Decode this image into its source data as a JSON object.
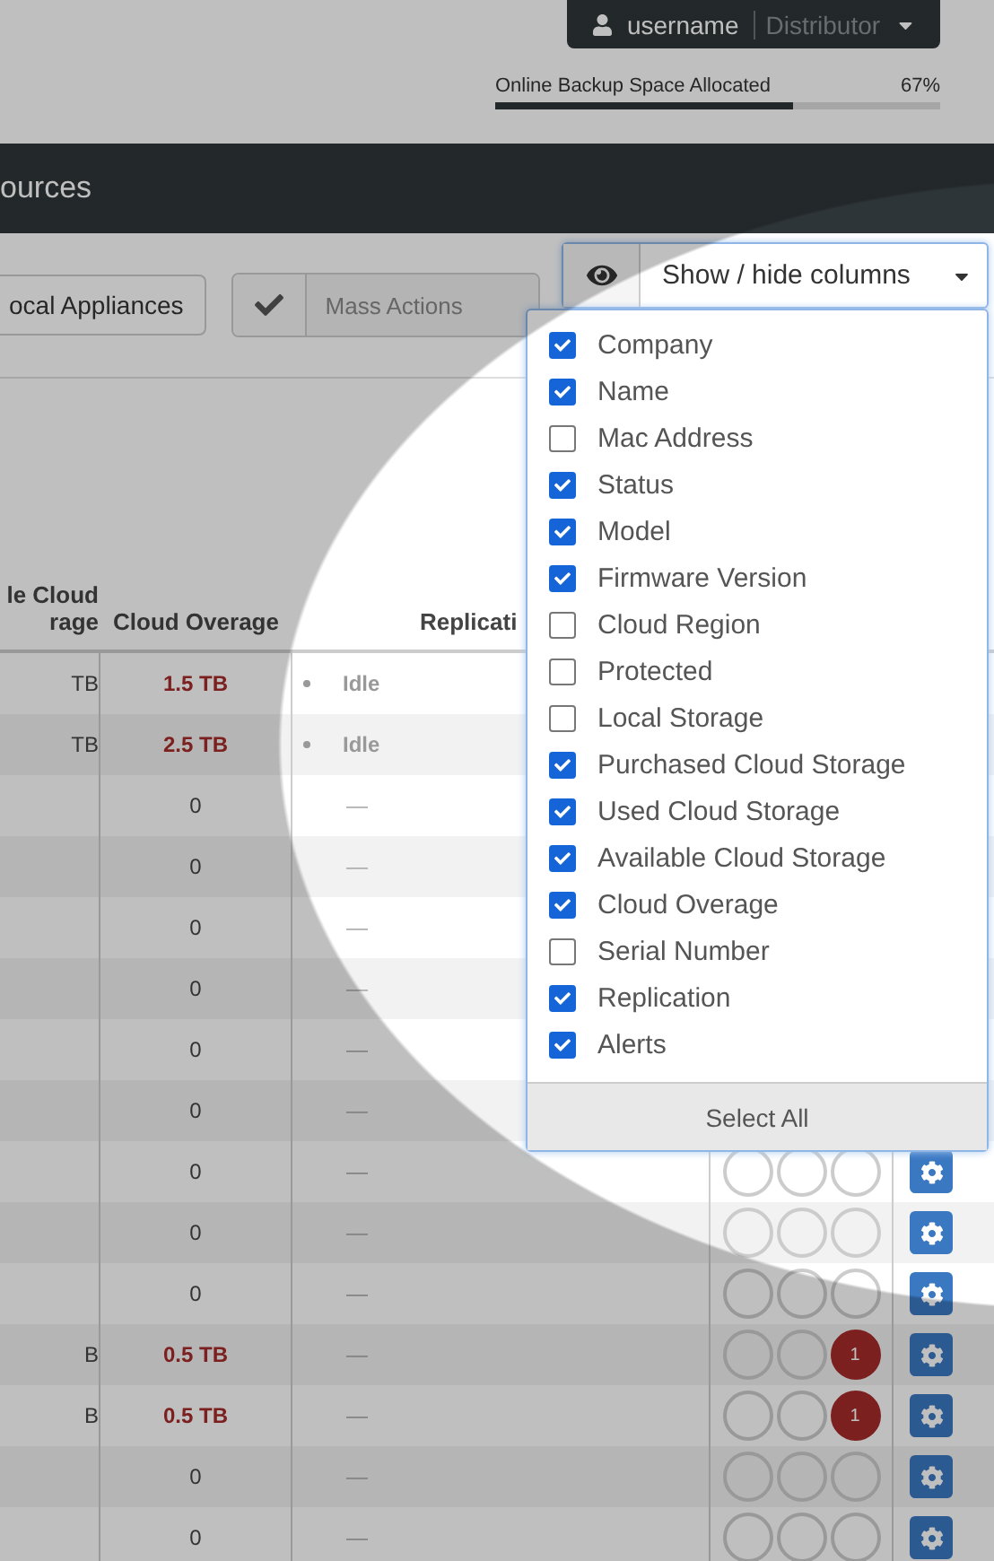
{
  "user_menu": {
    "name": "username",
    "role": "Distributor"
  },
  "storage": {
    "label": "Online Backup Space Allocated",
    "percent": "67%",
    "level": 0.67
  },
  "section_title": "ources",
  "toolbar": {
    "appliances_button": "ocal Appliances",
    "mass_actions": "Mass Actions"
  },
  "columns_menu": {
    "button": "Show / hide columns",
    "select_all": "Select All",
    "options": [
      {
        "label": "Company",
        "checked": true
      },
      {
        "label": "Name",
        "checked": true
      },
      {
        "label": "Mac Address",
        "checked": false
      },
      {
        "label": "Status",
        "checked": true
      },
      {
        "label": "Model",
        "checked": true
      },
      {
        "label": "Firmware Version",
        "checked": true
      },
      {
        "label": "Cloud Region",
        "checked": false
      },
      {
        "label": "Protected",
        "checked": false
      },
      {
        "label": "Local Storage",
        "checked": false
      },
      {
        "label": "Purchased Cloud Storage",
        "checked": true
      },
      {
        "label": "Used Cloud Storage",
        "checked": true
      },
      {
        "label": "Available Cloud Storage",
        "checked": true
      },
      {
        "label": "Cloud Overage",
        "checked": true
      },
      {
        "label": "Serial Number",
        "checked": false
      },
      {
        "label": "Replication",
        "checked": true
      },
      {
        "label": "Alerts",
        "checked": true
      }
    ]
  },
  "table": {
    "columns": [
      "le Cloud rage",
      "Cloud Overage",
      "Replicati"
    ],
    "rows": [
      {
        "column_1": "TB",
        "overage": "1.5 TB",
        "over": true,
        "replication": "Idle",
        "idle": true
      },
      {
        "column_1": "TB",
        "overage": "2.5 TB",
        "over": true,
        "replication": "Idle",
        "idle": true
      },
      {
        "overage": "0",
        "over": false,
        "replication": "—",
        "idle": false
      },
      {
        "overage": "0",
        "over": false,
        "replication": "—",
        "idle": false
      },
      {
        "overage": "0",
        "over": false,
        "replication": "—",
        "idle": false
      },
      {
        "overage": "0",
        "over": false,
        "replication": "—",
        "idle": false
      },
      {
        "overage": "0",
        "over": false,
        "replication": "—",
        "idle": false
      },
      {
        "overage": "0",
        "over": false,
        "replication": "—",
        "idle": false
      },
      {
        "overage": "0",
        "over": false,
        "replication": "—",
        "idle": false,
        "alerts": [
          {
            "active": false
          },
          {
            "active": false
          },
          {
            "active": false
          }
        ]
      },
      {
        "overage": "0",
        "over": false,
        "replication": "—",
        "idle": false,
        "alerts": [
          {
            "active": false
          },
          {
            "active": false
          },
          {
            "active": false
          }
        ]
      },
      {
        "overage": "0",
        "over": false,
        "replication": "—",
        "idle": false,
        "alerts": [
          {
            "active": false
          },
          {
            "active": false
          },
          {
            "active": false
          }
        ]
      },
      {
        "column_1": "B",
        "overage": "0.5 TB",
        "over": true,
        "replication": "—",
        "idle": false,
        "alerts": [
          {
            "active": false
          },
          {
            "active": false
          },
          {
            "active": true,
            "count": "1"
          }
        ]
      },
      {
        "column_1": "B",
        "overage": "0.5 TB",
        "over": true,
        "replication": "—",
        "idle": false,
        "alerts": [
          {
            "active": false
          },
          {
            "active": false
          },
          {
            "active": true,
            "count": "1"
          }
        ]
      },
      {
        "overage": "0",
        "over": false,
        "replication": "—",
        "idle": false,
        "alerts": [
          {
            "active": false
          },
          {
            "active": false
          },
          {
            "active": false
          }
        ]
      },
      {
        "overage": "0",
        "over": false,
        "replication": "—",
        "idle": false,
        "alerts": [
          {
            "active": false
          },
          {
            "active": false
          },
          {
            "active": false
          }
        ]
      }
    ]
  }
}
